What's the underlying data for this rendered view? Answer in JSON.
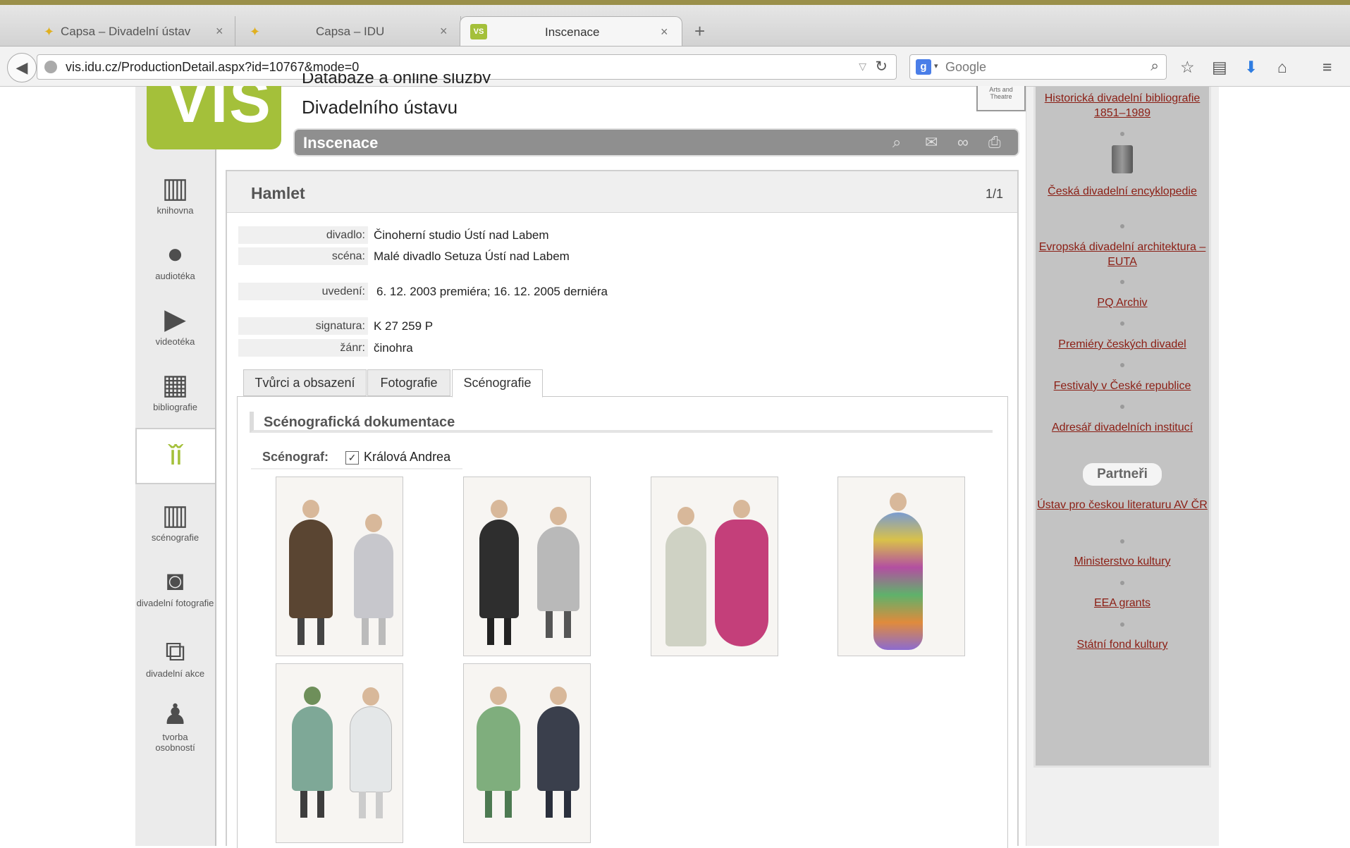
{
  "browser": {
    "tabs": [
      {
        "label": "Capsa – Divadelní ústav",
        "close": "×"
      },
      {
        "label": "Capsa – IDU",
        "close": "×"
      },
      {
        "label": "Inscenace",
        "close": "×",
        "icon_text": "VS"
      }
    ],
    "new_tab": "+",
    "url": "vis.idu.cz/ProductionDetail.aspx?id=10767&mode=0",
    "search_placeholder": "Google",
    "search_logo": "g"
  },
  "site": {
    "logo_text": "VIS",
    "subtitle_top": "Databáze a online služby",
    "subtitle": "Divadelního ústavu",
    "theatre_box": "Arts and Theatre",
    "section_bar": "Inscenace",
    "accent_color": "#a4c03a",
    "link_color": "#8b1e14"
  },
  "left_nav": [
    {
      "label": "knihovna",
      "icon": "library-icon"
    },
    {
      "label": "audiotéka",
      "icon": "microphone-icon"
    },
    {
      "label": "videotéka",
      "icon": "play-icon"
    },
    {
      "label": "bibliografie",
      "icon": "bibliography-icon"
    },
    {
      "label": "",
      "icon": "production-icon",
      "active": true
    },
    {
      "label": "scénografie",
      "icon": "scenography-icon"
    },
    {
      "label": "divadelní fotografie",
      "icon": "camera-icon"
    },
    {
      "label": "divadelní akce",
      "icon": "events-icon"
    },
    {
      "label": "tvorba osobností",
      "icon": "person-icon"
    }
  ],
  "record": {
    "title": "Hamlet",
    "count": "1/1",
    "fields": [
      {
        "label": "divadlo:",
        "value": "Činoherní studio Ústí nad Labem"
      },
      {
        "label": "scéna:",
        "value": "Malé divadlo Setuza Ústí nad Labem"
      },
      {
        "label": "uvedení:",
        "value": "6. 12. 2003 premiéra; 16. 12. 2005 derniéra"
      },
      {
        "label": "signatura:",
        "value": "K 27 259 P"
      },
      {
        "label": "žánr:",
        "value": "činohra"
      }
    ]
  },
  "content_tabs": [
    {
      "label": "Tvůrci a obsazení"
    },
    {
      "label": "Fotografie"
    },
    {
      "label": "Scénografie",
      "active": true
    }
  ],
  "scenography": {
    "section_title": "Scénografická dokumentace",
    "scenograph_label": "Scénograf:",
    "scenograph_checked": true,
    "scenograph_name": "Králová Andrea",
    "check_mark": "✓",
    "sketch_count": 6
  },
  "right_sidebar": {
    "links": [
      "Historická divadelní bibliografie 1851–1989",
      "Česká divadelní encyklopedie",
      "Evropská divadelní architektura – EUTA",
      "PQ Archiv",
      "Premiéry českých divadel",
      "Festivaly v České republice",
      "Adresář divadelních institucí"
    ],
    "partners_title": "Partneři",
    "partners": [
      "Ústav pro českou literaturu AV ČR",
      "Ministerstvo kultury",
      "EEA grants",
      "Státní fond kultury"
    ]
  }
}
